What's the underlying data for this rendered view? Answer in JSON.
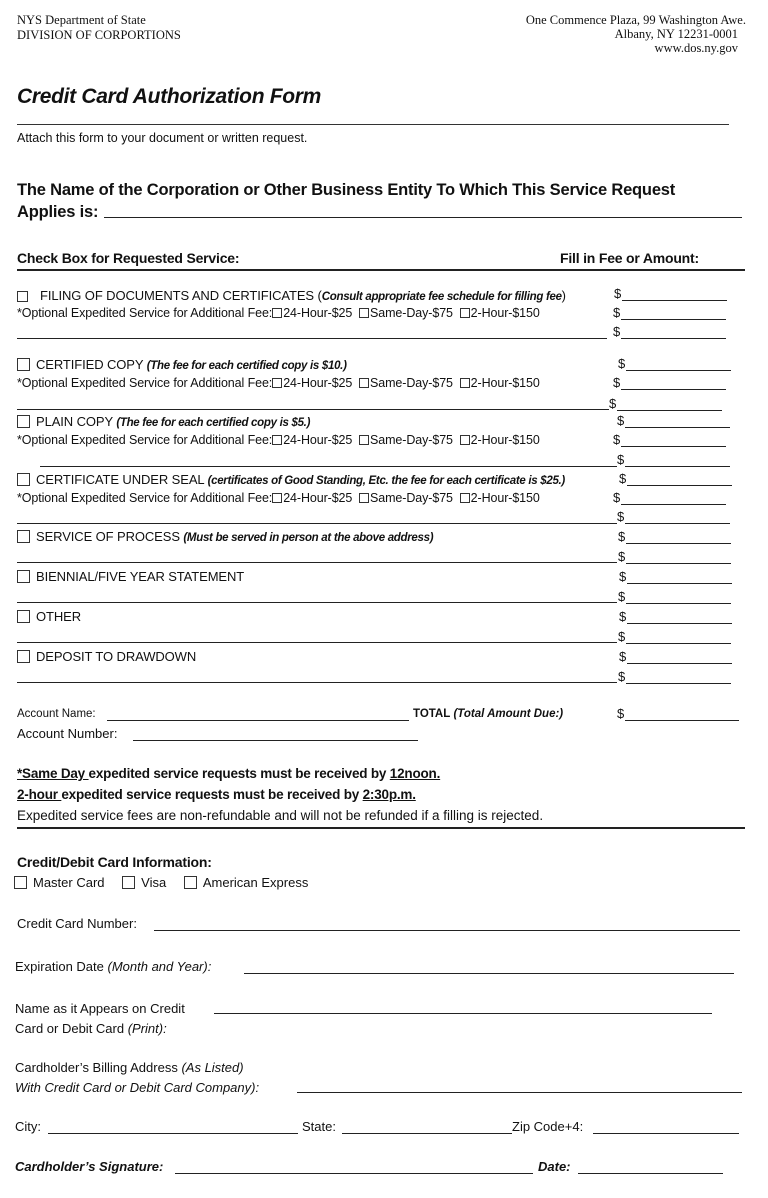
{
  "header": {
    "org_line1": "NYS Department of State",
    "org_line2": "DIVISION OF CORPORTIONS",
    "address_line1": "One Commence Plaza, 99 Washington Awe.",
    "address_line2": "Albany, NY 12231-0001",
    "website": "www.dos.ny.gov"
  },
  "title": "Credit Card Authorization Form",
  "attach_instruction": "Attach this form to your document or written request.",
  "entity_prompt": {
    "line1": "The Name of the Corporation or Other Business Entity To Which This Service Request",
    "line2": "Applies is:"
  },
  "services_header": {
    "left": "Check Box for Requested Service:",
    "right": "Fill in Fee or Amount:"
  },
  "currency_symbol": "$",
  "expedited": {
    "label": "*Optional Expedited Service for Additional Fee:",
    "options": [
      "24-Hour-$25",
      "Same-Day-$75",
      "2-Hour-$150"
    ]
  },
  "services": [
    {
      "label": "FILING OF DOCUMENTS AND CERTIFICATES (",
      "note": "Consult appropriate fee schedule for filling fee",
      "note_suffix": ")",
      "expedited": true
    },
    {
      "label": "CERTIFIED COPY",
      "note": "(The fee for each certified copy is $10.)",
      "expedited": true
    },
    {
      "label": "PLAIN COPY",
      "note": "(The fee for each certified copy is $5.)",
      "expedited": true
    },
    {
      "label": "CERTIFICATE UNDER SEAL",
      "note": "(certificates of Good Standing, Etc. the fee for each certificate is $25.)",
      "expedited": true
    },
    {
      "label": "SERVICE OF PROCESS",
      "note": "(Must be served in person at the above address)",
      "expedited": false
    },
    {
      "label": "BIENNIAL/FIVE YEAR STATEMENT",
      "note": "",
      "expedited": false
    },
    {
      "label": "OTHER",
      "note": "",
      "expedited": false
    },
    {
      "label": "DEPOSIT TO DRAWDOWN",
      "note": "",
      "expedited": false
    }
  ],
  "account": {
    "name_label": "Account Name:",
    "total_label": "TOTAL",
    "total_note": "(Total Amount Due:)",
    "number_label": "Account Number:"
  },
  "notices": {
    "same_day_prefix": "*Same Day ",
    "same_day_text": "expedited service requests must be received by ",
    "same_day_time": "12noon.",
    "two_hour_prefix": "2-hour ",
    "two_hour_text": "expedited service requests must be received by ",
    "two_hour_time": "2:30p.m.",
    "refund": "Expedited service fees are non-refundable and will not be refunded if a filling is rejected."
  },
  "card_info": {
    "heading": "Credit/Debit Card Information:",
    "card_types": [
      "Master Card",
      "Visa",
      "American Express"
    ],
    "card_number_label": "Credit Card Number:",
    "expiration_label": "Expiration Date ",
    "expiration_note": "(Month and Year):",
    "name_label_line1": "Name as it Appears on Credit",
    "name_label_line2": "Card or Debit Card ",
    "name_label_note": "(Print):",
    "billing_label_line1": "Cardholder’s Billing Address ",
    "billing_label_note": "(As Listed)",
    "billing_label_line2": "With Credit Card or Debit Card Company):",
    "city_label": "City:",
    "state_label": "State:",
    "zip_label": "Zip Code+4:",
    "signature_label": "Cardholder’s Signature:",
    "date_label": "Date:"
  }
}
